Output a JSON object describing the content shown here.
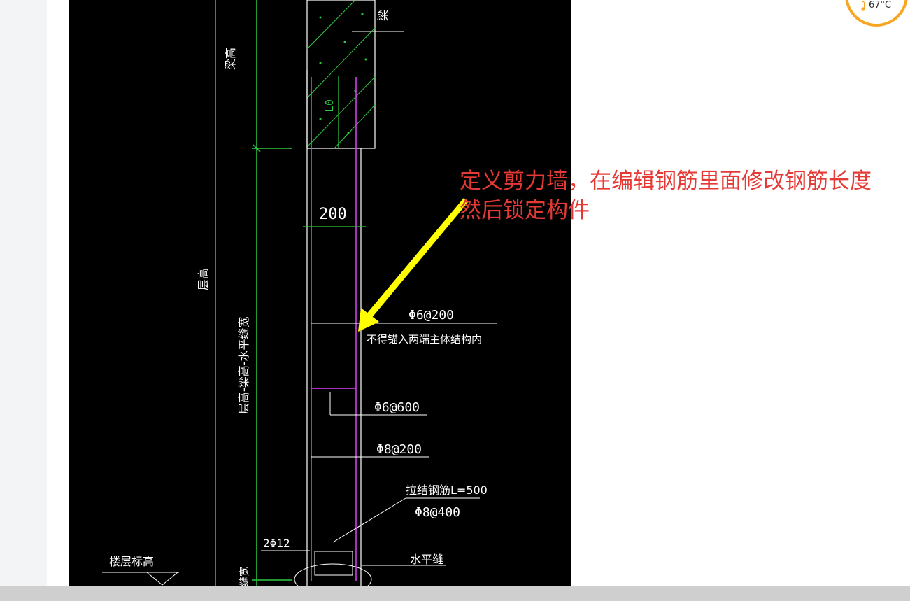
{
  "annotation": {
    "line1": "定义剪力墙，在编辑钢筋里面修改钢筋长度",
    "line2": "然后锁定构件",
    "color": "#e53935"
  },
  "widget": {
    "temperature": "67°C",
    "icon": "thermometer-icon",
    "accent": "#f6a623"
  },
  "drawing": {
    "label_beam": "梁",
    "label_beam_height": "梁高",
    "label_L0": "L0",
    "label_200": "200",
    "label_floor_height": "层高",
    "label_vertical_combo": "层高-梁高-水平缝宽",
    "label_phi6_200": "Φ6@200",
    "label_note": "不得锚入两端主体结构内",
    "label_phi6_600": "Φ6@600",
    "label_phi8_200": "Φ8@200",
    "label_tie": "拉结钢筋L=500",
    "label_phi8_400": "Φ8@400",
    "label_2phi12": "2Φ12",
    "label_floor_level": "楼层标高",
    "label_horizontal_joint": "水平缝",
    "label_joint_width": "缝宽"
  }
}
